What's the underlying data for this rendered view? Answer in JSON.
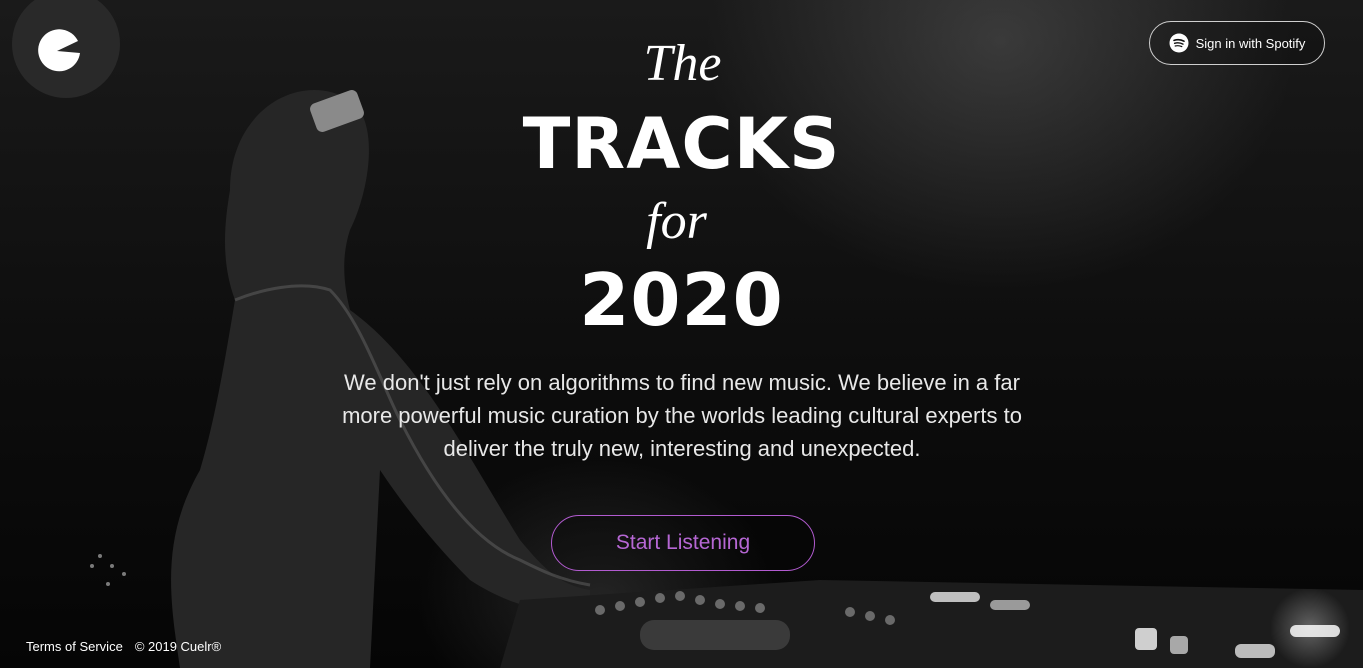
{
  "header": {
    "logo_icon": "cuelr-logo-icon",
    "spotify_button_label": "Sign in with Spotify",
    "spotify_icon": "spotify-icon"
  },
  "hero": {
    "line_the": "The",
    "line_tracks": "TRACKS",
    "line_for": "for",
    "line_year": "2020",
    "intro_text": "We don't just rely on algorithms to find new music. We believe in a far more powerful music curation by the worlds leading cultural experts to deliver the truly new, interesting and unexpected.",
    "cta_label": "Start Listening"
  },
  "footer": {
    "terms_label": "Terms of Service",
    "copyright": "© 2019 Cuelr®"
  },
  "colors": {
    "accent": "#b667d4",
    "background": "#0d0d0d",
    "text": "#ffffff"
  }
}
